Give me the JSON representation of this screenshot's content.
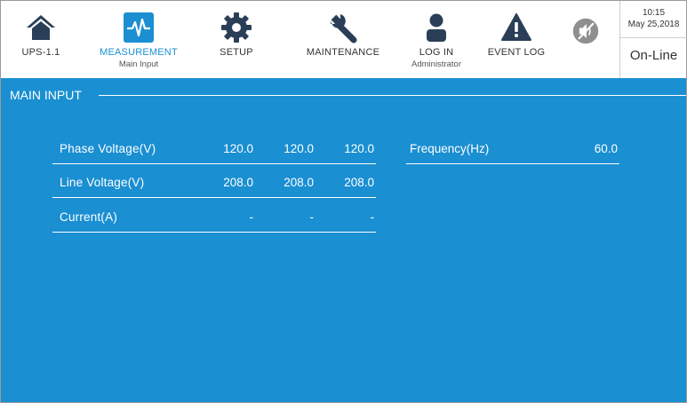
{
  "nav": [
    {
      "id": "ups",
      "label": "UPS-1.1",
      "sub": "",
      "icon": "home-icon"
    },
    {
      "id": "measurement",
      "label": "MEASUREMENT",
      "sub": "Main Input",
      "icon": "pulse-icon"
    },
    {
      "id": "setup",
      "label": "SETUP",
      "sub": "",
      "icon": "gear-icon"
    },
    {
      "id": "maintenance",
      "label": "MAINTENANCE",
      "sub": "",
      "icon": "wrench-icon"
    },
    {
      "id": "login",
      "label": "LOG IN",
      "sub": "Administrator",
      "icon": "user-icon"
    },
    {
      "id": "eventlog",
      "label": "EVENT LOG",
      "sub": "",
      "icon": "warning-icon"
    }
  ],
  "mute_icon": "mute-icon",
  "status": {
    "time": "10:15",
    "date": "May 25,2018",
    "state": "On-Line"
  },
  "panel": {
    "title": "MAIN INPUT"
  },
  "table": [
    {
      "name": "Phase Voltage(V)",
      "values": [
        "120.0",
        "120.0",
        "120.0"
      ]
    },
    {
      "name": "Line Voltage(V)",
      "values": [
        "208.0",
        "208.0",
        "208.0"
      ]
    },
    {
      "name": "Current(A)",
      "values": [
        "-",
        "-",
        "-"
      ]
    }
  ],
  "frequency": {
    "name": "Frequency(Hz)",
    "value": "60.0"
  },
  "colors": {
    "accent": "#1a8fd2",
    "icon_dark": "#2a3f57",
    "mute_gray": "#8f8f8f"
  }
}
